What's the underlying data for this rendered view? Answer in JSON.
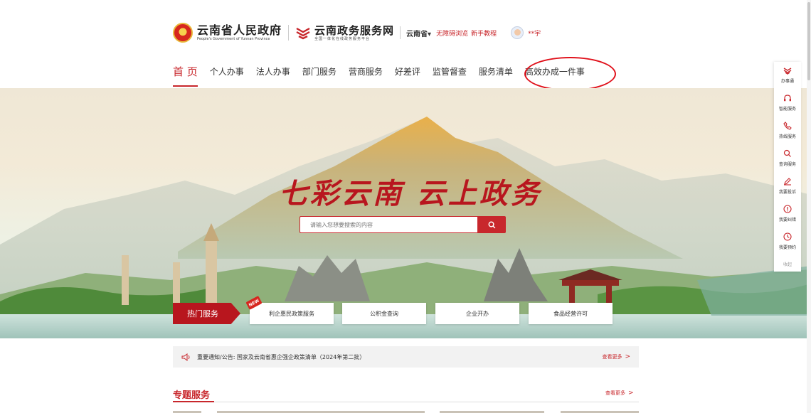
{
  "header": {
    "gov_title": "云南省人民政府",
    "gov_subtitle": "People's Government of Yunnan Province",
    "service_title": "云南政务服务网",
    "service_subtitle": "全国一体化在线政务服务平台",
    "region": "云南省",
    "region_caret": "▾",
    "accessibility": "无障碍浏览",
    "tutorial": "新手教程",
    "user_name": "**宇"
  },
  "nav": {
    "items": [
      "首 页",
      "个人办事",
      "法人办事",
      "部门服务",
      "营商服务",
      "好差评",
      "监管督查",
      "服务清单",
      "高效办成一件事"
    ]
  },
  "hero": {
    "slogan": "七彩云南 云上政务",
    "search_placeholder": "请输入您想要搜索的内容",
    "hot_label": "热门服务",
    "new_badge": "NEW",
    "hot_services": [
      "利企惠民政策服务",
      "公积金查询",
      "企业开办",
      "食品经营许可"
    ]
  },
  "notice": {
    "text": "重要通知/公告:  国家及云南省惠企强企政策清单（2024年第二批）",
    "more": "查看更多",
    "more_arrow": ">"
  },
  "topic": {
    "title": "专题服务",
    "more": "查看更多",
    "more_arrow": ">"
  },
  "sidebar": {
    "items": [
      "办事通",
      "智能服务",
      "热线服务",
      "查询服务",
      "我要投诉",
      "我要纠错",
      "我要预约"
    ],
    "collapse": "收起"
  },
  "colors": {
    "brand_red": "#c8272c",
    "dark_red": "#b8161e"
  }
}
